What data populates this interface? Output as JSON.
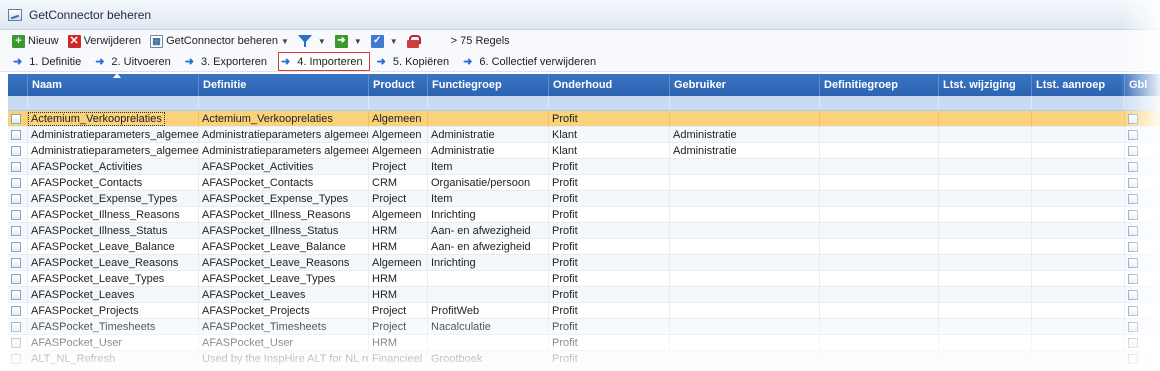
{
  "window": {
    "title": "GetConnector beheren"
  },
  "toolbar": {
    "new_label": "Nieuw",
    "delete_label": "Verwijderen",
    "manage_label": "GetConnector beheren",
    "count_label": "> 75 Regels"
  },
  "steps": [
    {
      "label": "1. Definitie"
    },
    {
      "label": "2. Uitvoeren"
    },
    {
      "label": "3. Exporteren"
    },
    {
      "label": "4. Importeren"
    },
    {
      "label": "5. Kopiëren"
    },
    {
      "label": "6. Collectief verwijderen"
    }
  ],
  "columns": {
    "naam": "Naam",
    "definitie": "Definitie",
    "product": "Product",
    "functiegroep": "Functiegroep",
    "onderhoud": "Onderhoud",
    "gebruiker": "Gebruiker",
    "definitiegroep": "Definitiegroep",
    "ltst_wijziging": "Ltst. wijziging",
    "ltst_aanroep": "Ltst. aanroep",
    "gbl": "Gbl"
  },
  "rows": [
    {
      "naam": "Actemium_Verkooprelaties",
      "definitie": "Actemium_Verkooprelaties",
      "product": "Algemeen",
      "functiegroep": "",
      "onderhoud": "Profit",
      "gebruiker": ""
    },
    {
      "naam": "Administratieparameters_algemeen",
      "definitie": "Administratieparameters algemeen",
      "product": "Algemeen",
      "functiegroep": "Administratie",
      "onderhoud": "Klant",
      "gebruiker": "Administratie"
    },
    {
      "naam": "Administratieparameters_algemeen_",
      "definitie": "Administratieparameters algemeen",
      "product": "Algemeen",
      "functiegroep": "Administratie",
      "onderhoud": "Klant",
      "gebruiker": "Administratie"
    },
    {
      "naam": "AFASPocket_Activities",
      "definitie": "AFASPocket_Activities",
      "product": "Project",
      "functiegroep": "Item",
      "onderhoud": "Profit",
      "gebruiker": ""
    },
    {
      "naam": "AFASPocket_Contacts",
      "definitie": "AFASPocket_Contacts",
      "product": "CRM",
      "functiegroep": "Organisatie/persoon",
      "onderhoud": "Profit",
      "gebruiker": ""
    },
    {
      "naam": "AFASPocket_Expense_Types",
      "definitie": "AFASPocket_Expense_Types",
      "product": "Project",
      "functiegroep": "Item",
      "onderhoud": "Profit",
      "gebruiker": ""
    },
    {
      "naam": "AFASPocket_Illness_Reasons",
      "definitie": "AFASPocket_Illness_Reasons",
      "product": "Algemeen",
      "functiegroep": "Inrichting",
      "onderhoud": "Profit",
      "gebruiker": ""
    },
    {
      "naam": "AFASPocket_Illness_Status",
      "definitie": "AFASPocket_Illness_Status",
      "product": "HRM",
      "functiegroep": "Aan- en afwezigheid",
      "onderhoud": "Profit",
      "gebruiker": ""
    },
    {
      "naam": "AFASPocket_Leave_Balance",
      "definitie": "AFASPocket_Leave_Balance",
      "product": "HRM",
      "functiegroep": "Aan- en afwezigheid",
      "onderhoud": "Profit",
      "gebruiker": ""
    },
    {
      "naam": "AFASPocket_Leave_Reasons",
      "definitie": "AFASPocket_Leave_Reasons",
      "product": "Algemeen",
      "functiegroep": "Inrichting",
      "onderhoud": "Profit",
      "gebruiker": ""
    },
    {
      "naam": "AFASPocket_Leave_Types",
      "definitie": "AFASPocket_Leave_Types",
      "product": "HRM",
      "functiegroep": "",
      "onderhoud": "Profit",
      "gebruiker": ""
    },
    {
      "naam": "AFASPocket_Leaves",
      "definitie": "AFASPocket_Leaves",
      "product": "HRM",
      "functiegroep": "",
      "onderhoud": "Profit",
      "gebruiker": ""
    },
    {
      "naam": "AFASPocket_Projects",
      "definitie": "AFASPocket_Projects",
      "product": "Project",
      "functiegroep": "ProfitWeb",
      "onderhoud": "Profit",
      "gebruiker": ""
    },
    {
      "naam": "AFASPocket_Timesheets",
      "definitie": "AFASPocket_Timesheets",
      "product": "Project",
      "functiegroep": "Nacalculatie",
      "onderhoud": "Profit",
      "gebruiker": ""
    },
    {
      "naam": "AFASPocket_User",
      "definitie": "AFASPocket_User",
      "product": "HRM",
      "functiegroep": "",
      "onderhoud": "Profit",
      "gebruiker": ""
    },
    {
      "naam": "ALT_NL_Refresh",
      "definitie": "Used by the InspHire ALT for NL re",
      "product": "Financieel",
      "functiegroep": "Grootboek",
      "onderhoud": "Profit",
      "gebruiker": ""
    }
  ],
  "colors": {
    "header": "#2c63b0",
    "selected_row": "#fbd27c",
    "active_step_border": "#d9393b"
  }
}
